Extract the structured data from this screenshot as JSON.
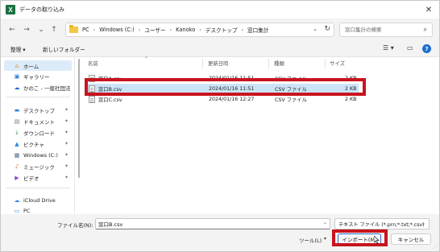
{
  "window": {
    "title": "データの取り込み",
    "app_icon_letter": "X",
    "close_glyph": "✕"
  },
  "nav": {
    "back_glyph": "←",
    "forward_glyph": "→",
    "down_glyph": "⌄",
    "up_glyph": "↑",
    "breadcrumb": [
      "PC",
      "Windows (C:)",
      "ユーザー",
      "Kanoko",
      "デスクトップ",
      "窓口集計"
    ],
    "breadcrumb_sep": "›",
    "dropdown_glyph": "⌄",
    "refresh_glyph": "↻",
    "search_placeholder": "窓口集計の検索",
    "search_glyph": "⌕"
  },
  "toolbar": {
    "organize": "整理 ▾",
    "new_folder": "新しいフォルダー",
    "view_glyph": "☰ ▾",
    "pane_glyph": "▭",
    "help_glyph": "?"
  },
  "sidebar": {
    "items": [
      {
        "label": "ホーム",
        "icon": "home-icon",
        "glyph": "⌂",
        "color": "#e08b1f",
        "pinned": false,
        "active": true
      },
      {
        "label": "ギャラリー",
        "icon": "gallery-icon",
        "glyph": "▣",
        "color": "#2f7fd6",
        "pinned": false,
        "active": false
      },
      {
        "label": "かのこ - 一般社団法",
        "icon": "onedrive-icon",
        "glyph": "☁",
        "color": "#1b6fd0",
        "pinned": false,
        "active": false
      },
      {
        "label": "デスクトップ",
        "icon": "desktop-icon",
        "glyph": "▬",
        "color": "#2f86d8",
        "pinned": true,
        "active": false
      },
      {
        "label": "ドキュメント",
        "icon": "documents-icon",
        "glyph": "▤",
        "color": "#6a7b8c",
        "pinned": true,
        "active": false
      },
      {
        "label": "ダウンロード",
        "icon": "downloads-icon",
        "glyph": "↓",
        "color": "#2b9a4a",
        "pinned": true,
        "active": false
      },
      {
        "label": "ピクチャ",
        "icon": "pictures-icon",
        "glyph": "▲",
        "color": "#2f86d8",
        "pinned": true,
        "active": false
      },
      {
        "label": "Windows (C:)",
        "icon": "drive-icon",
        "glyph": "▦",
        "color": "#4a6a8a",
        "pinned": true,
        "active": false
      },
      {
        "label": "ミュージック",
        "icon": "music-icon",
        "glyph": "♪",
        "color": "#e2553a",
        "pinned": true,
        "active": false
      },
      {
        "label": "ビデオ",
        "icon": "videos-icon",
        "glyph": "▶",
        "color": "#8a4ad0",
        "pinned": true,
        "active": false
      },
      {
        "label": "iCloud Drive",
        "icon": "icloud-icon",
        "glyph": "☁",
        "color": "#3a8ee6",
        "pinned": false,
        "active": false
      },
      {
        "label": "PC",
        "icon": "pc-icon",
        "glyph": "▭",
        "color": "#2f86d8",
        "pinned": false,
        "active": false
      }
    ],
    "pin_glyph": "✦"
  },
  "filelist": {
    "columns": [
      "名前",
      "更新日時",
      "種類",
      "サイズ"
    ],
    "sort_glyph": "^",
    "rows": [
      {
        "name": "窓口A.csv",
        "modified": "2024/01/16 11:51",
        "type": "CSV ファイル",
        "size": "2 KB",
        "selected": false
      },
      {
        "name": "窓口B.csv",
        "modified": "2024/01/16 11:51",
        "type": "CSV ファイル",
        "size": "2 KB",
        "selected": true
      },
      {
        "name": "窓口C.csv",
        "modified": "2024/01/16 12:27",
        "type": "CSV ファイル",
        "size": "2 KB",
        "selected": false
      }
    ]
  },
  "bottom": {
    "filename_label": "ファイル名(N):",
    "filename_value": "窓口B.csv",
    "filetype_value": "テキスト ファイル (*.prn;*.txt;*.csv)",
    "tools_label": "ツール(L)",
    "import_label": "インポート(M)",
    "cancel_label": "キャンセル",
    "drop_glyph": "⌄"
  },
  "colors": {
    "highlight": "#c8141e",
    "selection": "#cce4f7",
    "accent": "#1f6fd1"
  }
}
